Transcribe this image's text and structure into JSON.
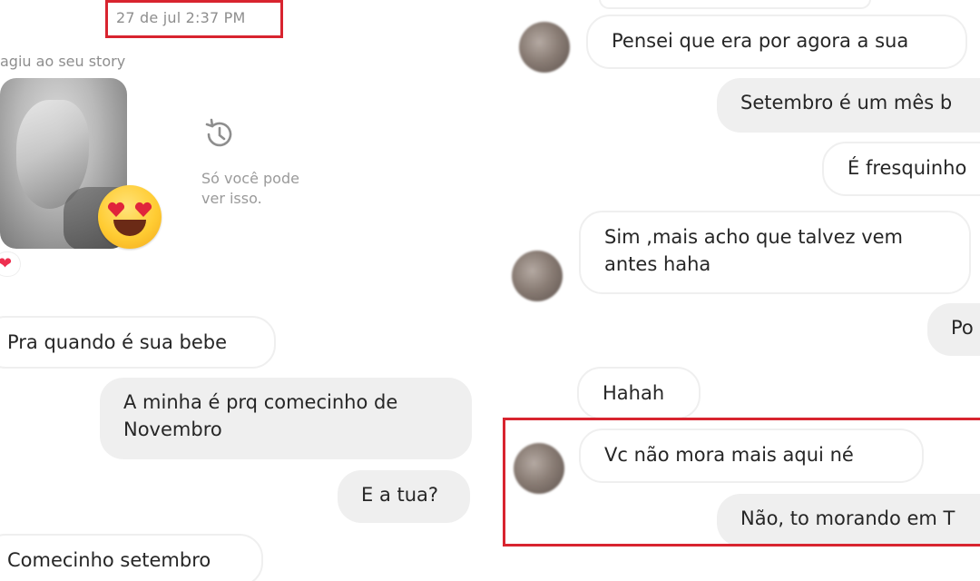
{
  "left": {
    "timestamp": "27 de jul 2:37 PM",
    "reacted_label": "agiu ao seu story",
    "private_note_line1": "Só você pode",
    "private_note_line2": "ver isso.",
    "heart": "❤",
    "messages": [
      {
        "text": "Pra quando é sua bebe"
      },
      {
        "line1": "A minha é prq comecinho de",
        "line2": "Novembro"
      },
      {
        "text": "E a tua?"
      },
      {
        "text": "Comecinho setembro"
      }
    ]
  },
  "right": {
    "messages": [
      {
        "text": "Pensei que era por agora a sua"
      },
      {
        "text": "Setembro é um mês b"
      },
      {
        "text": "É fresquinho"
      },
      {
        "line1": "Sim ,mais acho que talvez vem",
        "line2": "antes haha"
      },
      {
        "text": "Po"
      },
      {
        "text": "Hahah"
      },
      {
        "text": "Vc não mora mais aqui né"
      },
      {
        "text": "Não, to morando em T"
      }
    ]
  },
  "colors": {
    "highlight": "#d8242f",
    "incoming_bubble": "#ffffff",
    "outgoing_bubble": "#efefef",
    "heart": "#ed2f4f"
  },
  "icons": [
    "history-icon",
    "heart-icon",
    "heart-eyes-emoji"
  ]
}
